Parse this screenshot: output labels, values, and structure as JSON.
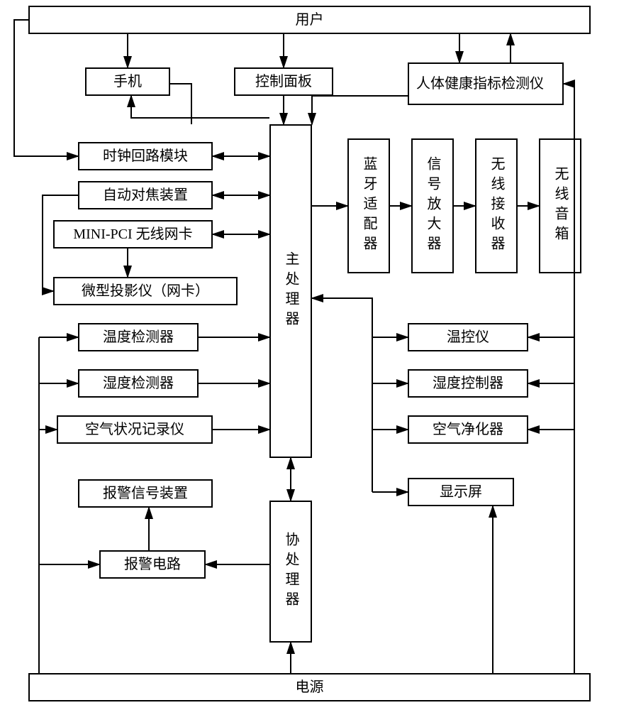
{
  "chart_data": {
    "type": "diagram",
    "title": "",
    "nodes": [
      "用户",
      "手机",
      "控制面板",
      "人体健康指标检测仪",
      "时钟回路模块",
      "自动对焦装置",
      "MINI-PCI 无线网卡",
      "微型投影仪（网卡）",
      "温度检测器",
      "湿度检测器",
      "空气状况记录仪",
      "报警信号装置",
      "报警电路",
      "主处理器",
      "协处理器",
      "蓝牙适配器",
      "信号放大器",
      "无线接收器",
      "无线音箱",
      "温控仪",
      "湿度控制器",
      "空气净化器",
      "显示屏",
      "电源"
    ],
    "edges": [
      {
        "from": "用户",
        "to": "手机",
        "dir": "uni"
      },
      {
        "from": "用户",
        "to": "控制面板",
        "dir": "uni"
      },
      {
        "from": "用户",
        "to": "人体健康指标检测仪",
        "dir": "bi"
      },
      {
        "from": "手机",
        "to": "主处理器",
        "dir": "bi"
      },
      {
        "from": "控制面板",
        "to": "主处理器",
        "dir": "uni"
      },
      {
        "from": "人体健康指标检测仪",
        "to": "主处理器",
        "dir": "uni"
      },
      {
        "from": "时钟回路模块",
        "to": "主处理器",
        "dir": "bi"
      },
      {
        "from": "自动对焦装置",
        "to": "主处理器",
        "dir": "bi"
      },
      {
        "from": "MINI-PCI 无线网卡",
        "to": "主处理器",
        "dir": "bi"
      },
      {
        "from": "MINI-PCI 无线网卡",
        "to": "微型投影仪（网卡）",
        "dir": "uni"
      },
      {
        "from": "自动对焦装置",
        "to": "微型投影仪（网卡）",
        "dir": "uni"
      },
      {
        "from": "温度检测器",
        "to": "主处理器",
        "dir": "uni"
      },
      {
        "from": "湿度检测器",
        "to": "主处理器",
        "dir": "uni"
      },
      {
        "from": "空气状况记录仪",
        "to": "主处理器",
        "dir": "uni"
      },
      {
        "from": "主处理器",
        "to": "蓝牙适配器",
        "dir": "uni"
      },
      {
        "from": "蓝牙适配器",
        "to": "信号放大器",
        "dir": "uni"
      },
      {
        "from": "信号放大器",
        "to": "无线接收器",
        "dir": "uni"
      },
      {
        "from": "无线接收器",
        "to": "无线音箱",
        "dir": "uni"
      },
      {
        "from": "主处理器",
        "to": "温控仪",
        "dir": "uni"
      },
      {
        "from": "主处理器",
        "to": "湿度控制器",
        "dir": "uni"
      },
      {
        "from": "主处理器",
        "to": "空气净化器",
        "dir": "uni"
      },
      {
        "from": "主处理器",
        "to": "显示屏",
        "dir": "uni"
      },
      {
        "from": "主处理器",
        "to": "协处理器",
        "dir": "bi"
      },
      {
        "from": "协处理器",
        "to": "报警电路",
        "dir": "uni"
      },
      {
        "from": "报警电路",
        "to": "报警信号装置",
        "dir": "uni"
      },
      {
        "from": "电源",
        "to": "协处理器",
        "dir": "uni"
      },
      {
        "from": "电源",
        "to": "显示屏",
        "dir": "uni"
      },
      {
        "from": "电源",
        "to": "温度检测器",
        "dir": "uni"
      },
      {
        "from": "电源",
        "to": "湿度检测器",
        "dir": "uni"
      },
      {
        "from": "电源",
        "to": "空气状况记录仪",
        "dir": "uni"
      },
      {
        "from": "电源",
        "to": "报警电路",
        "dir": "uni"
      },
      {
        "from": "电源",
        "to": "微型投影仪（网卡）",
        "dir": "uni"
      },
      {
        "from": "电源",
        "to": "时钟回路模块",
        "dir": "uni"
      },
      {
        "from": "电源",
        "to": "温控仪",
        "dir": "uni"
      },
      {
        "from": "电源",
        "to": "湿度控制器",
        "dir": "uni"
      },
      {
        "from": "电源",
        "to": "空气净化器",
        "dir": "uni"
      },
      {
        "from": "电源",
        "to": "人体健康指标检测仪",
        "dir": "uni"
      },
      {
        "from": "用户",
        "to": "时钟回路模块",
        "dir": "wire"
      }
    ]
  },
  "labels": {
    "user": "用户",
    "phone": "手机",
    "panel": "控制面板",
    "health": "人体健康指标检测仪",
    "clock": "时钟回路模块",
    "autofocus": "自动对焦装置",
    "wifi": "MINI-PCI 无线网卡",
    "projector": "微型投影仪（网卡）",
    "temp_det": "温度检测器",
    "humid_det": "湿度检测器",
    "air_rec": "空气状况记录仪",
    "alarm_sig": "报警信号装置",
    "alarm_ckt": "报警电路",
    "main_cpu": "主处理器",
    "co_cpu": "协处理器",
    "bt": "蓝牙适配器",
    "amp": "信号放大器",
    "rx": "无线接收器",
    "spk": "无线音箱",
    "temp_ctrl": "温控仪",
    "humid_ctrl": "湿度控制器",
    "air_pur": "空气净化器",
    "display": "显示屏",
    "power": "电源"
  }
}
